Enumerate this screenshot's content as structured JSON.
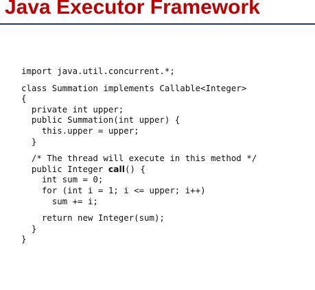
{
  "slide": {
    "title": "Java Executor Framework"
  },
  "code": {
    "lines": [
      "import java.util.concurrent.*;",
      "",
      "class Summation implements Callable<Integer>",
      "{",
      "  private int upper;",
      "  public Summation(int upper) {",
      "    this.upper = upper;",
      "  }",
      "",
      "  /* The thread will execute in this method */",
      "  public Integer ",
      "call",
      "() {",
      "    int sum = 0;",
      "    for (int i = 1; i <= upper; i++)",
      "      sum += i;",
      "",
      "    return new Integer(sum);",
      "  }",
      "}"
    ]
  }
}
